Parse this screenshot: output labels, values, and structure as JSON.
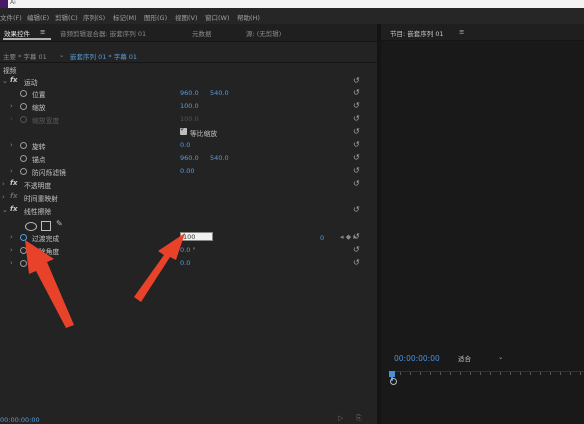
{
  "titlebar": {
    "title": "Ai"
  },
  "menubar": {
    "items": [
      "文件(F)",
      "编辑(E)",
      "剪辑(C)",
      "序列(S)",
      "标记(M)",
      "图形(G)",
      "视图(V)",
      "窗口(W)",
      "帮助(H)"
    ]
  },
  "left_panel": {
    "tabs": [
      "效果控件",
      "音频剪辑混合器: 嵌套序列 01",
      "元数据",
      "源: (无剪辑)"
    ],
    "tab_menu_icon": "≡",
    "source_clip": "主要 * 字幕 01",
    "sequence_clip": "嵌套序列 01 * 字幕 01",
    "section": "视频",
    "motion": {
      "label": "运动",
      "position": {
        "label": "位置",
        "x": "960.0",
        "y": "540.0"
      },
      "scale": {
        "label": "缩放",
        "value": "100.0"
      },
      "scale_width": {
        "label": "缩放宽度",
        "value": "100.0"
      },
      "uniform_scale": {
        "label": "等比缩放",
        "checked": true
      },
      "rotation": {
        "label": "旋转",
        "value": "0.0"
      },
      "anchor": {
        "label": "锚点",
        "x": "960.0",
        "y": "540.0"
      },
      "anti_flicker": {
        "label": "防闪烁滤镜",
        "value": "0.00"
      }
    },
    "opacity": {
      "label": "不透明度"
    },
    "time_remap": {
      "label": "时间重映射"
    },
    "linear_wipe": {
      "label": "线性擦除",
      "transition_completion": {
        "label": "过渡完成",
        "value": "100"
      },
      "wipe_angle": {
        "label": "擦除角度",
        "value": "0.0 °"
      },
      "feather": {
        "label": "羽化",
        "value": "0.0"
      }
    },
    "keyframe_value": "0",
    "timecode": "00:00:00:00"
  },
  "right_panel": {
    "title": "节目: 嵌套序列 01",
    "menu_icon": "≡",
    "timecode": "00:00:00:00",
    "fit": "适合"
  },
  "icons": {
    "reset": "reset-icon",
    "stopwatch": "stopwatch-icon",
    "fx": "fx-badge",
    "twirl": "twirl-arrow-icon"
  },
  "colors": {
    "accent": "#5a9bd8",
    "annotation": "#e8432a"
  }
}
